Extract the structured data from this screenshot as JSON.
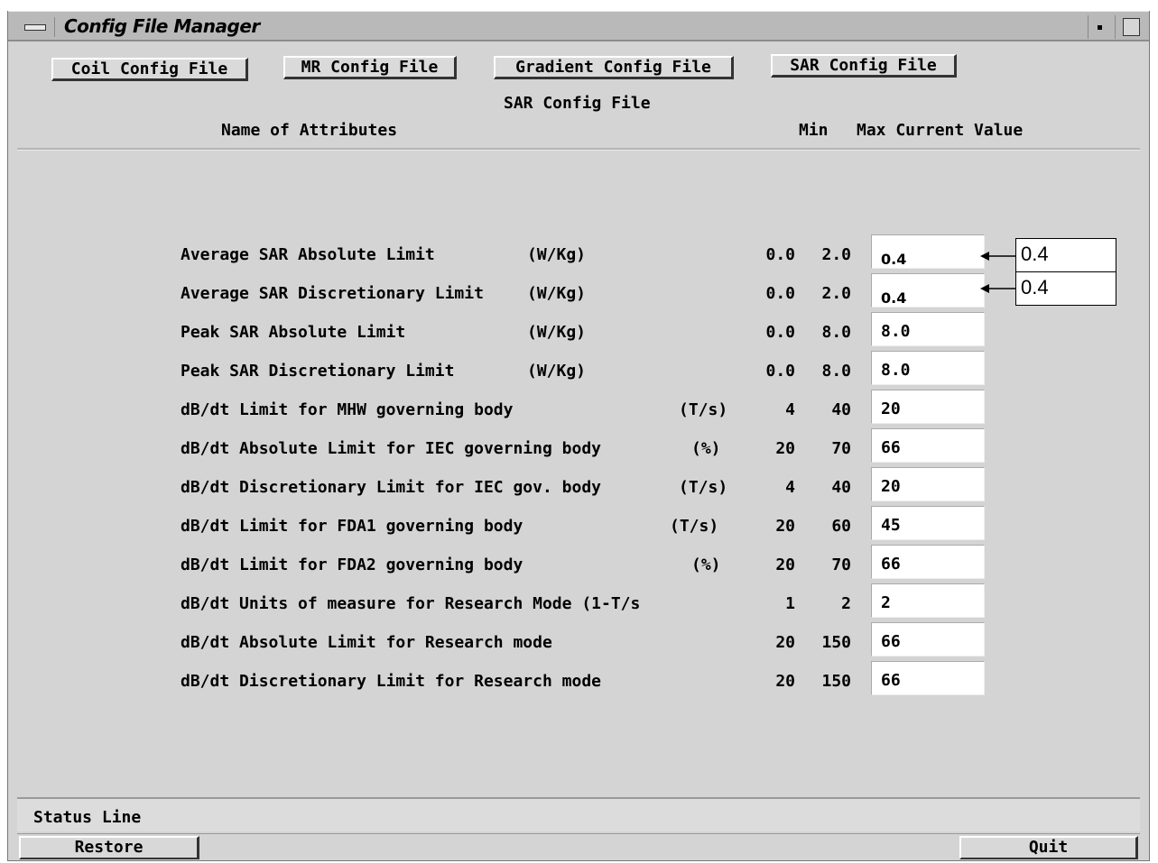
{
  "window": {
    "title": "Config File Manager"
  },
  "tabs": [
    {
      "label": "Coil Config File"
    },
    {
      "label": "MR Config File"
    },
    {
      "label": "Gradient Config File"
    },
    {
      "label": "SAR Config File"
    }
  ],
  "section_title": "SAR Config File",
  "columns": {
    "name": "Name of Attributes",
    "min": "Min",
    "max_current": "Max Current Value"
  },
  "rows": [
    {
      "label": "Average SAR Absolute Limit",
      "unit": "(W/Kg)",
      "min": "0.0",
      "max": "2.0",
      "value": "0.4"
    },
    {
      "label": "Average SAR Discretionary Limit",
      "unit": "(W/Kg)",
      "min": "0.0",
      "max": "2.0",
      "value": "0.4"
    },
    {
      "label": "Peak SAR Absolute Limit",
      "unit": "(W/Kg)",
      "min": "0.0",
      "max": "8.0",
      "value": "8.0"
    },
    {
      "label": "Peak SAR Discretionary Limit",
      "unit": "(W/Kg)",
      "min": "0.0",
      "max": "8.0",
      "value": "8.0"
    },
    {
      "label": "dB/dt Limit for MHW governing body",
      "unit": "(T/s)",
      "min": "4",
      "max": "40",
      "value": "20"
    },
    {
      "label": "dB/dt Absolute Limit for IEC governing body",
      "unit": "(%)",
      "min": "20",
      "max": "70",
      "value": "66"
    },
    {
      "label": "dB/dt Discretionary Limit for IEC gov. body",
      "unit": "(T/s)",
      "min": "4",
      "max": "40",
      "value": "20"
    },
    {
      "label": "dB/dt Limit for FDA1 governing body",
      "unit": "(T/s)",
      "min": "20",
      "max": "60",
      "value": "45"
    },
    {
      "label": "dB/dt Limit for FDA2 governing body",
      "unit": "(%)",
      "min": "20",
      "max": "70",
      "value": "66"
    },
    {
      "label": "dB/dt Units of measure for Research Mode (1-T/s",
      "unit": "",
      "min": "1",
      "max": "2",
      "value": "2"
    },
    {
      "label": "dB/dt Absolute Limit for Research mode",
      "unit": "",
      "min": "20",
      "max": "150",
      "value": "66"
    },
    {
      "label": "dB/dt Discretionary Limit for Research mode",
      "unit": "",
      "min": "20",
      "max": "150",
      "value": "66"
    }
  ],
  "callouts": [
    {
      "text": "0.4"
    },
    {
      "text": "0.4"
    }
  ],
  "status": {
    "text": "Status Line"
  },
  "buttons": {
    "restore": "Restore",
    "quit": "Quit"
  }
}
